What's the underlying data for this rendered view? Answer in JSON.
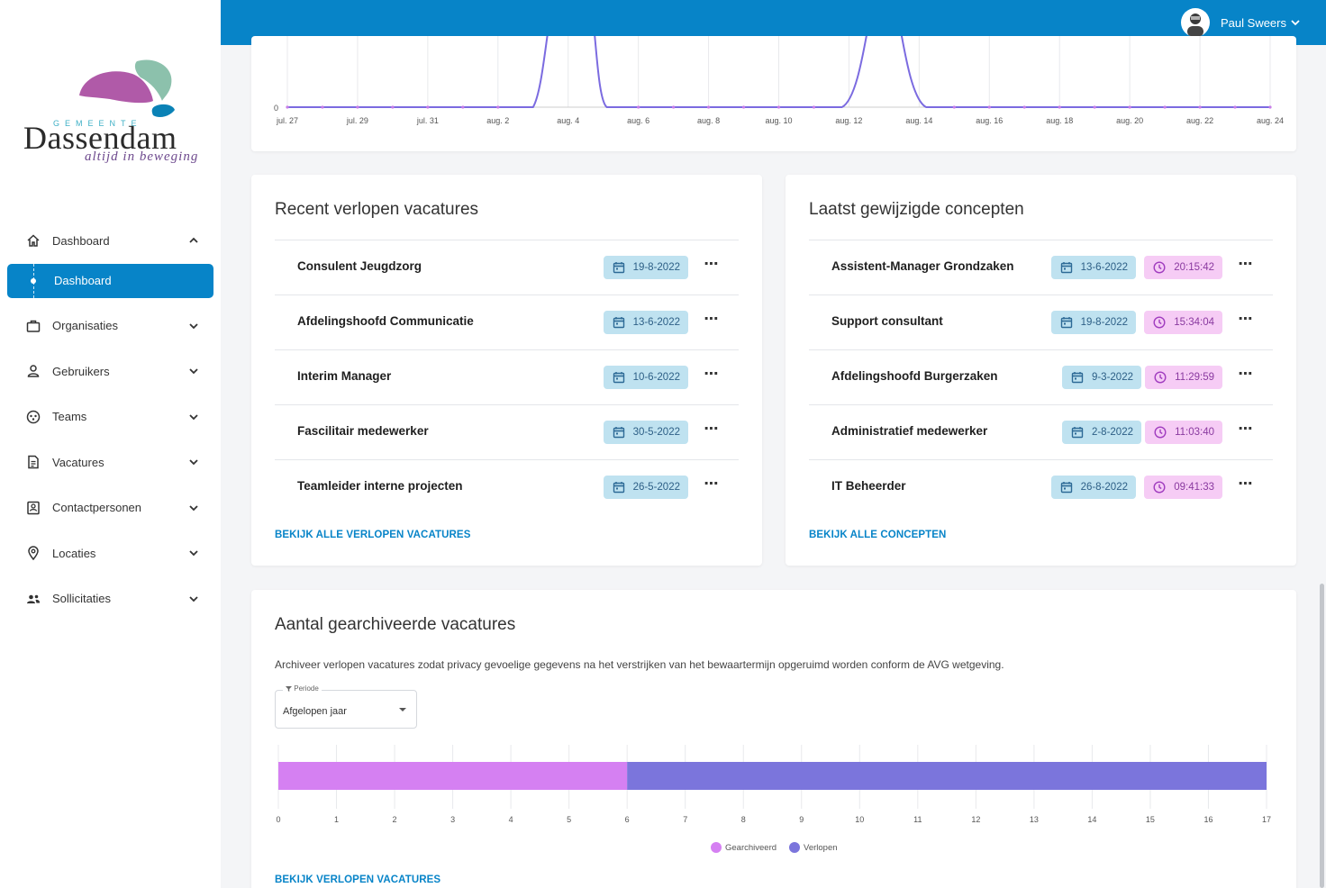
{
  "brand": {
    "name": "Dassendam",
    "prefix": "GEMEENTE",
    "tagline": "altijd in beweging",
    "primary": "#0784c8"
  },
  "user": {
    "name": "Paul Sweers"
  },
  "sidebar": {
    "items": [
      {
        "label": "Dashboard",
        "icon": "home-icon",
        "expanded": true
      },
      {
        "label": "Organisaties",
        "icon": "briefcase-icon"
      },
      {
        "label": "Gebruikers",
        "icon": "user-icon"
      },
      {
        "label": "Teams",
        "icon": "teams-icon"
      },
      {
        "label": "Vacatures",
        "icon": "document-icon"
      },
      {
        "label": "Contactpersonen",
        "icon": "contact-card-icon"
      },
      {
        "label": "Locaties",
        "icon": "location-pin-icon"
      },
      {
        "label": "Sollicitaties",
        "icon": "people-icon"
      }
    ],
    "active_sub": "Dashboard"
  },
  "top_chart": {
    "x_ticks": [
      "jul. 27",
      "jul. 29",
      "jul. 31",
      "aug. 2",
      "aug. 4",
      "aug. 6",
      "aug. 8",
      "aug. 10",
      "aug. 12",
      "aug. 14",
      "aug. 16",
      "aug. 18",
      "aug. 20",
      "aug. 22",
      "aug. 24"
    ],
    "y_label": "0"
  },
  "expired": {
    "title": "Recent verlopen vacatures",
    "rows": [
      {
        "name": "Consulent Jeugdzorg",
        "date": "19-8-2022"
      },
      {
        "name": "Afdelingshoofd Communicatie",
        "date": "13-6-2022"
      },
      {
        "name": "Interim Manager",
        "date": "10-6-2022"
      },
      {
        "name": "Fascilitair medewerker",
        "date": "30-5-2022"
      },
      {
        "name": "Teamleider interne projecten",
        "date": "26-5-2022"
      }
    ],
    "more": "⋯",
    "link": "BEKIJK ALLE VERLOPEN VACATURES"
  },
  "concepts": {
    "title": "Laatst gewijzigde concepten",
    "rows": [
      {
        "name": "Assistent-Manager Grondzaken",
        "date": "13-6-2022",
        "time": "20:15:42"
      },
      {
        "name": "Support consultant",
        "date": "19-8-2022",
        "time": "15:34:04"
      },
      {
        "name": "Afdelingshoofd Burgerzaken",
        "date": "9-3-2022",
        "time": "11:29:59"
      },
      {
        "name": "Administratief medewerker",
        "date": "2-8-2022",
        "time": "11:03:40"
      },
      {
        "name": "IT Beheerder",
        "date": "26-8-2022",
        "time": "09:41:33"
      }
    ],
    "more": "⋯",
    "link": "BEKIJK ALLE CONCEPTEN"
  },
  "archived": {
    "title": "Aantal gearchiveerde vacatures",
    "description": "Archiveer verlopen vacatures zodat privacy gevoelige gegevens na het verstrijken van het bewaartermijn opgeruimd worden conform de AVG wetgeving.",
    "filter": {
      "label": "Periode",
      "value": "Afgelopen jaar"
    },
    "link": "BEKIJK VERLOPEN VACATURES"
  },
  "chart_data": [
    {
      "type": "line",
      "x": [
        "jul. 27",
        "jul. 29",
        "jul. 31",
        "aug. 2",
        "aug. 4",
        "aug. 6",
        "aug. 8",
        "aug. 10",
        "aug. 12",
        "aug. 14",
        "aug. 16",
        "aug. 18",
        "aug. 20",
        "aug. 22",
        "aug. 24"
      ],
      "ylim": [
        0,
        null
      ],
      "y_ticks": [
        "0"
      ],
      "color": "#7b6be0",
      "peaks_near": [
        "aug. 3",
        "aug. 12"
      ],
      "note_visible": "cropped at top"
    },
    {
      "type": "bar",
      "orientation": "horizontal",
      "stacked": true,
      "xlim": [
        0,
        17
      ],
      "x_ticks": [
        0,
        1,
        2,
        3,
        4,
        5,
        6,
        7,
        8,
        9,
        10,
        11,
        12,
        13,
        14,
        15,
        16,
        17
      ],
      "series": [
        {
          "name": "Gearchiveerd",
          "value": 6,
          "color": "#d580f2"
        },
        {
          "name": "Verlopen",
          "value": 11,
          "color": "#7b75dc"
        }
      ],
      "legend": "bottom-center"
    }
  ]
}
